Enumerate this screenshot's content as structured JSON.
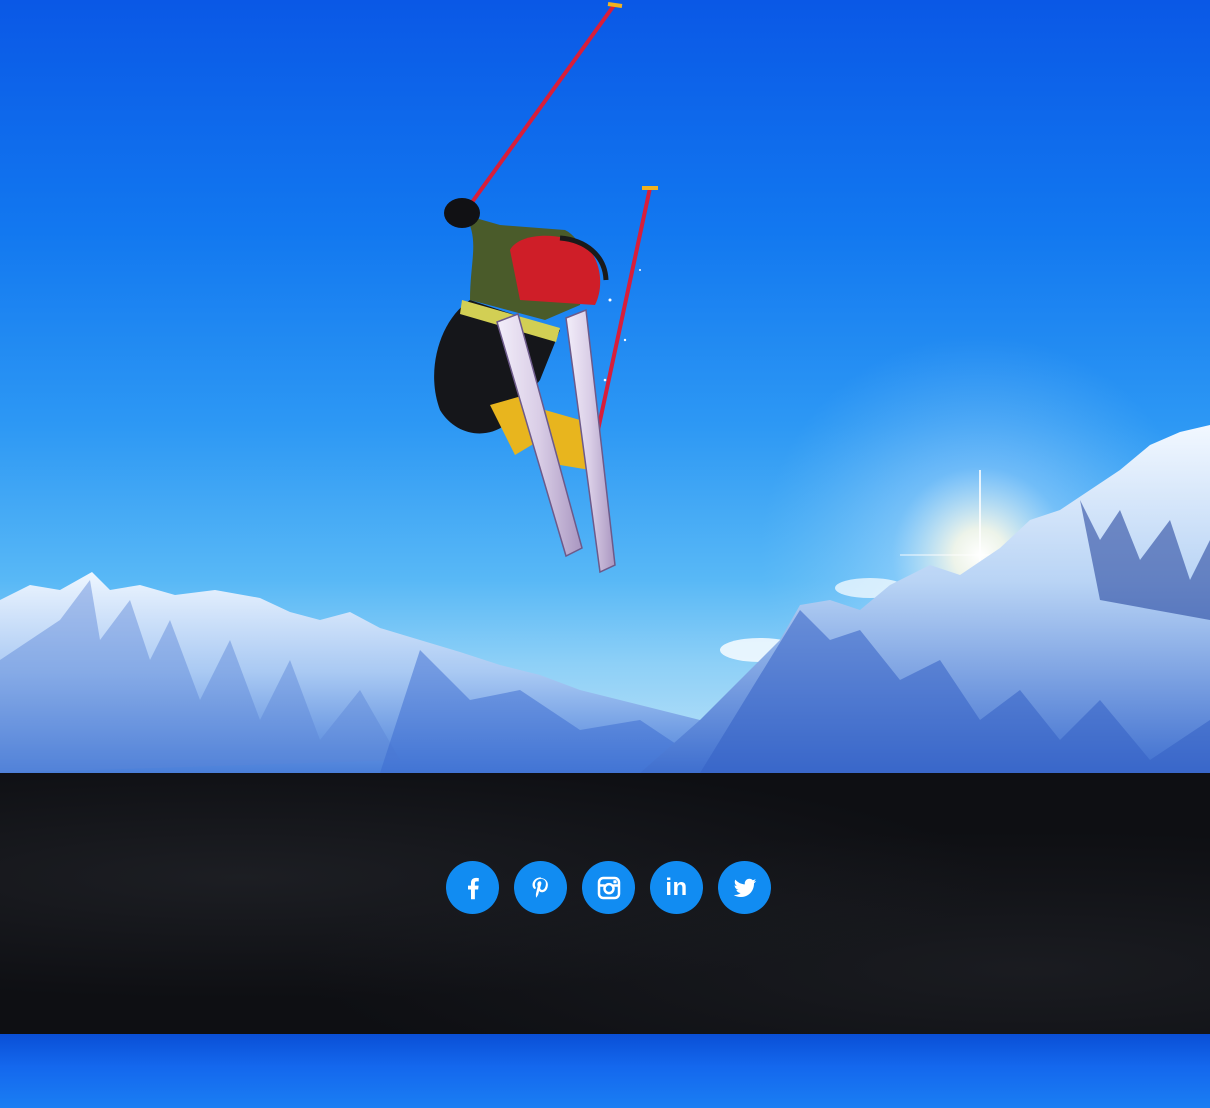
{
  "hero": {
    "image": "skier-jumping-over-snowy-mountains"
  },
  "social": {
    "accent_color": "#118cf2",
    "items": [
      {
        "id": "facebook",
        "icon": "facebook-icon"
      },
      {
        "id": "pinterest",
        "icon": "pinterest-icon"
      },
      {
        "id": "instagram",
        "icon": "instagram-icon"
      },
      {
        "id": "linkedin",
        "icon": "linkedin-icon",
        "glyph": "in"
      },
      {
        "id": "twitter",
        "icon": "twitter-icon"
      }
    ]
  },
  "colors": {
    "footer_band": "#0e0f13",
    "bottom_strip": "#1468ee"
  }
}
